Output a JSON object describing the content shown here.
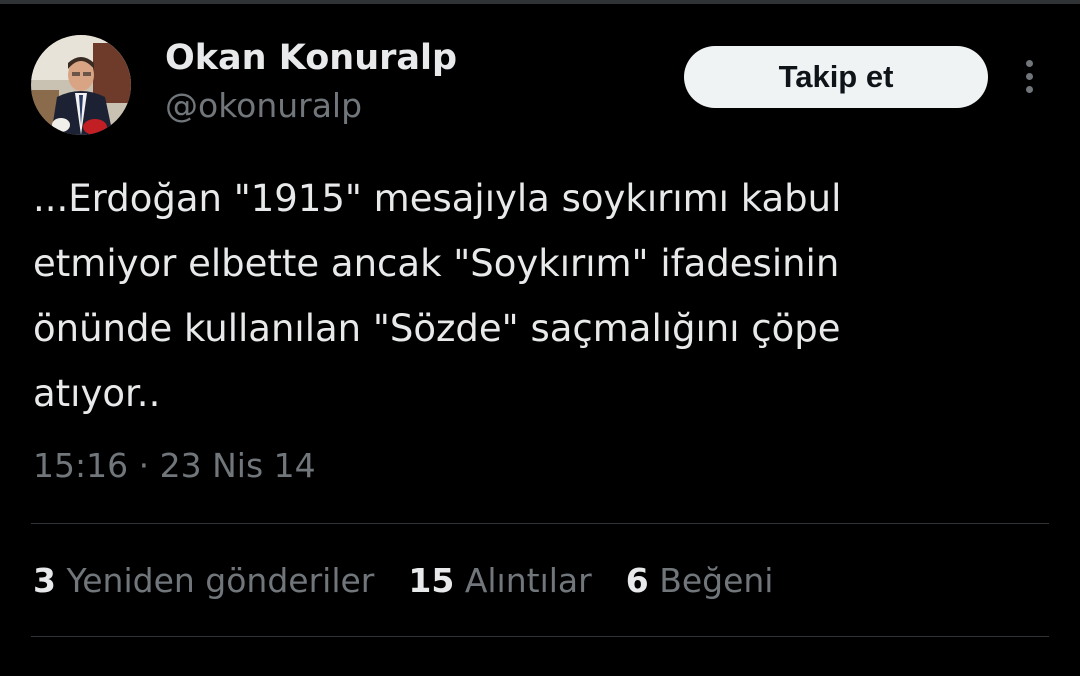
{
  "author": {
    "display_name": "Okan Konuralp",
    "handle": "@okonuralp"
  },
  "follow_label": "Takip et",
  "tweet": {
    "lines": [
      "...Erdoğan \"1915\" mesajıyla soykırımı kabul",
      "etmiyor elbette ancak \"Soykırım\" ifadesinin",
      "önünde kullanılan \"Sözde\" saçmalığını çöpe",
      "atıyor.."
    ],
    "time": "15:16",
    "separator": "·",
    "date": "23 Nis 14"
  },
  "stats": {
    "reposts": {
      "count": "3",
      "label": "Yeniden gönderiler"
    },
    "quotes": {
      "count": "15",
      "label": "Alıntılar"
    },
    "likes": {
      "count": "6",
      "label": "Beğeni"
    }
  },
  "icons": {
    "more": "more-vertical-icon"
  },
  "colors": {
    "background": "#000000",
    "primary_text": "#e7e9ea",
    "secondary_text": "#71767b",
    "divider": "#2f3336",
    "button_bg": "#eff3f4",
    "button_text": "#0f1419"
  }
}
